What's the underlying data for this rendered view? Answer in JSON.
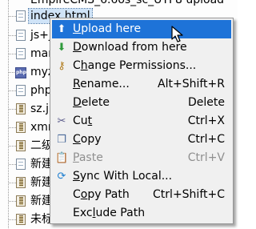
{
  "tree": {
    "top_partial": "EmpireCMS_6.6os_sc_UTF8 upload",
    "items": [
      {
        "label": "index.html",
        "icon": "html-file-icon"
      },
      {
        "label": "js+j",
        "icon": "file-icon"
      },
      {
        "label": "mar",
        "icon": "file-icon"
      },
      {
        "label": "myz",
        "icon": "php-file-icon"
      },
      {
        "label": "php",
        "icon": "file-icon"
      },
      {
        "label": "sz.jp",
        "icon": "jpg-file-icon"
      },
      {
        "label": "xmr",
        "icon": "file-icon"
      },
      {
        "label": "二级",
        "icon": "file-icon"
      },
      {
        "label": "新建",
        "icon": "file-icon"
      },
      {
        "label": "新建",
        "icon": "file-icon"
      },
      {
        "label": "新建",
        "icon": "file-icon"
      },
      {
        "label": "未标",
        "icon": "file-icon"
      }
    ]
  },
  "menu": {
    "items": [
      {
        "pre": "",
        "u": "U",
        "post": "pload here",
        "shortcut": "",
        "icon": "upload-icon",
        "glyph": "⬆",
        "color": "#2d6fc4"
      },
      {
        "pre": "",
        "u": "D",
        "post": "ownload from here",
        "shortcut": "",
        "icon": "download-icon",
        "glyph": "⬇",
        "color": "#2e9a3b"
      },
      {
        "pre": "C",
        "u": "h",
        "post": "ange Permissions...",
        "shortcut": "",
        "icon": "permissions-icon",
        "glyph": "⚷",
        "color": "#b07a1a"
      },
      {
        "pre": "",
        "u": "R",
        "post": "ename...",
        "shortcut": "Alt+Shift+R",
        "icon": "",
        "glyph": "",
        "color": ""
      },
      {
        "pre": "",
        "u": "D",
        "post": "elete",
        "shortcut": "Delete",
        "icon": "",
        "glyph": "",
        "color": ""
      },
      {
        "pre": "Cu",
        "u": "t",
        "post": "",
        "shortcut": "Ctrl+X",
        "icon": "cut-icon",
        "glyph": "✂",
        "color": "#5a5a8a"
      },
      {
        "pre": "",
        "u": "C",
        "post": "opy",
        "shortcut": "Ctrl+C",
        "icon": "copy-icon",
        "glyph": "❐",
        "color": "#4a6a9a"
      },
      {
        "pre": "",
        "u": "P",
        "post": "aste",
        "shortcut": "Ctrl+V",
        "icon": "paste-icon",
        "glyph": "📋",
        "color": "#9a9a9a"
      },
      {
        "pre": "",
        "u": "S",
        "post": "ync With Local...",
        "shortcut": "",
        "icon": "sync-icon",
        "glyph": "⟳",
        "color": "#1f7fd0"
      },
      {
        "pre": "C",
        "u": "o",
        "post": "py Path",
        "shortcut": "Ctrl+Shift+C",
        "icon": "",
        "glyph": "",
        "color": ""
      },
      {
        "pre": "Exc",
        "u": "l",
        "post": "ude Path",
        "shortcut": "",
        "icon": "",
        "glyph": "",
        "color": ""
      }
    ]
  }
}
